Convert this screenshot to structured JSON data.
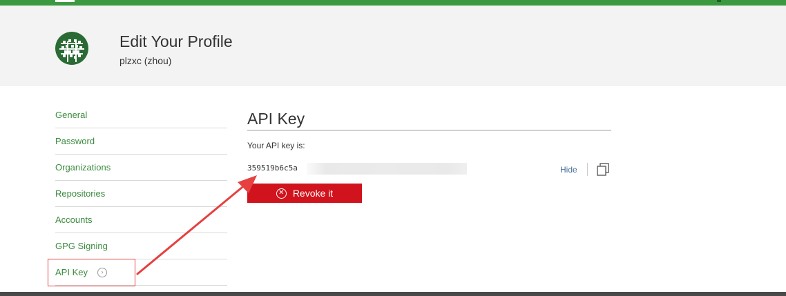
{
  "header": {
    "title": "Edit Your Profile",
    "username": "plzxc (zhou)"
  },
  "sidebar": {
    "items": [
      {
        "label": "General"
      },
      {
        "label": "Password"
      },
      {
        "label": "Organizations"
      },
      {
        "label": "Repositories"
      },
      {
        "label": "Accounts"
      },
      {
        "label": "GPG Signing"
      },
      {
        "label": "API Key"
      }
    ],
    "active_item": "API Key"
  },
  "main": {
    "section_title": "API Key",
    "key_label": "Your API key is:",
    "key_value_visible": "359519b6c5a",
    "hide_label": "Hide",
    "revoke_label": "Revoke it"
  },
  "colors": {
    "topbar": "#3b9a3f",
    "link_green": "#3b8a3f",
    "revoke_red": "#d0131c",
    "annotation_red": "#e64040"
  },
  "icons": {
    "avatar": "identicon-avatar",
    "copy": "copy-icon",
    "revoke": "close-circle-icon",
    "active_item": "chevron-right-circle-icon"
  }
}
